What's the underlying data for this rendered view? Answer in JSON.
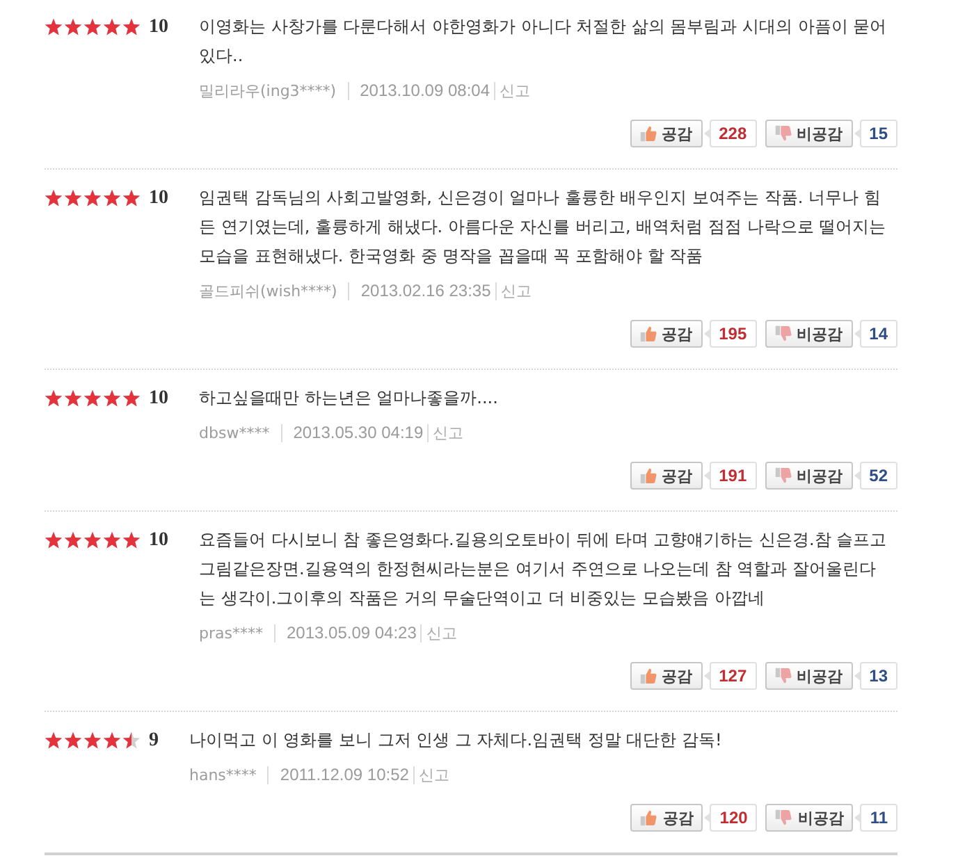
{
  "reviews": [
    {
      "stars": 5,
      "score": "10",
      "text": "이영화는 사창가를 다룬다해서 야한영화가 아니다 처절한 삶의 몸부림과 시대의 아픔이 묻어있다..",
      "author": "밀리라우(ing3****)",
      "date": "2013.10.09 08:04",
      "report": "신고",
      "like": {
        "label": "공감",
        "count": "228"
      },
      "dislike": {
        "label": "비공감",
        "count": "15"
      }
    },
    {
      "stars": 5,
      "score": "10",
      "text": "임권택 감독님의 사회고발영화, 신은경이 얼마나 훌륭한 배우인지 보여주는 작품. 너무나 힘든 연기였는데, 훌륭하게 해냈다. 아름다운 자신를 버리고, 배역처럼 점점 나락으로 떨어지는 모습을 표현해냈다. 한국영화 중 명작을 꼽을때 꼭 포함해야 할 작품",
      "author": "골드피쉬(wish****)",
      "date": "2013.02.16 23:35",
      "report": "신고",
      "like": {
        "label": "공감",
        "count": "195"
      },
      "dislike": {
        "label": "비공감",
        "count": "14"
      }
    },
    {
      "stars": 5,
      "score": "10",
      "text": "하고싶을때만 하는년은 얼마나좋을까....",
      "author": "dbsw****",
      "date": "2013.05.30 04:19",
      "report": "신고",
      "like": {
        "label": "공감",
        "count": "191"
      },
      "dislike": {
        "label": "비공감",
        "count": "52"
      }
    },
    {
      "stars": 5,
      "score": "10",
      "text": "요즘들어 다시보니 참 좋은영화다.길용의오토바이 뒤에 타며 고향얘기하는 신은경.참 슬프고 그림같은장면.길용역의 한정현씨라는분은 여기서 주연으로 나오는데 참 역할과 잘어울린다는 생각이.그이후의 작품은 거의 무술단역이고 더 비중있는 모습봤음 아깝네",
      "author": "pras****",
      "date": "2013.05.09 04:23",
      "report": "신고",
      "like": {
        "label": "공감",
        "count": "127"
      },
      "dislike": {
        "label": "비공감",
        "count": "13"
      }
    },
    {
      "stars": 4.5,
      "score": "9",
      "text": "나이먹고 이 영화를 보니 그저 인생 그 자체다.임권택 정말 대단한 감독!",
      "author": "hans****",
      "date": "2011.12.09 10:52",
      "report": "신고",
      "like": {
        "label": "공감",
        "count": "120"
      },
      "dislike": {
        "label": "비공감",
        "count": "11"
      }
    }
  ]
}
